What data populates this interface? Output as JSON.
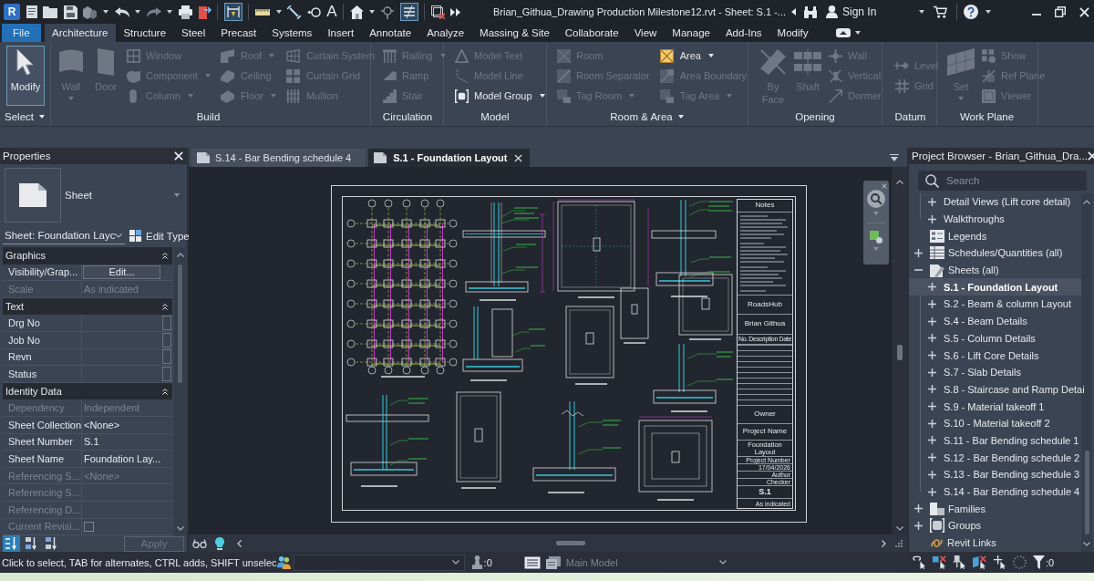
{
  "title_bar": {
    "logo": "R",
    "text_tool": "A",
    "title": "Brian_Githua_Drawing Production Milestone12.rvt - Sheet: S.1 -...",
    "sign_in": "Sign In"
  },
  "ribbon_tabs": [
    {
      "label": "File",
      "kind": "file",
      "selected": false
    },
    {
      "label": "Architecture",
      "kind": "tab",
      "selected": true
    },
    {
      "label": "Structure",
      "kind": "tab",
      "selected": false
    },
    {
      "label": "Steel",
      "kind": "tab",
      "selected": false
    },
    {
      "label": "Precast",
      "kind": "tab",
      "selected": false
    },
    {
      "label": "Systems",
      "kind": "tab",
      "selected": false
    },
    {
      "label": "Insert",
      "kind": "tab",
      "selected": false
    },
    {
      "label": "Annotate",
      "kind": "tab",
      "selected": false
    },
    {
      "label": "Analyze",
      "kind": "tab",
      "selected": false
    },
    {
      "label": "Massing & Site",
      "kind": "tab",
      "selected": false
    },
    {
      "label": "Collaborate",
      "kind": "tab",
      "selected": false
    },
    {
      "label": "View",
      "kind": "tab",
      "selected": false
    },
    {
      "label": "Manage",
      "kind": "tab",
      "selected": false
    },
    {
      "label": "Add-Ins",
      "kind": "tab",
      "selected": false
    },
    {
      "label": "Modify",
      "kind": "tab",
      "selected": false
    }
  ],
  "ribbon_panels": [
    {
      "label": "Select",
      "menu": true,
      "columns": [
        {
          "kind": "large",
          "label": "Modify",
          "disabled": false,
          "active": true,
          "menu": false
        }
      ]
    },
    {
      "label": "Build",
      "menu": false,
      "columns": [
        {
          "kind": "large",
          "label": "Wall",
          "disabled": true,
          "active": false,
          "menu": true
        },
        {
          "kind": "large",
          "label": "Door",
          "disabled": true,
          "active": false,
          "menu": false
        },
        {
          "kind": "stack",
          "tools": [
            {
              "label": "Window",
              "disabled": true,
              "menu": false
            },
            {
              "label": "Component",
              "disabled": true,
              "menu": true
            },
            {
              "label": "Column",
              "disabled": true,
              "menu": true
            }
          ]
        },
        {
          "kind": "stack",
          "tools": [
            {
              "label": "Roof",
              "disabled": true,
              "menu": true
            },
            {
              "label": "Ceiling",
              "disabled": true,
              "menu": false
            },
            {
              "label": "Floor",
              "disabled": true,
              "menu": true
            }
          ]
        },
        {
          "kind": "stack",
          "tools": [
            {
              "label": "Curtain System",
              "disabled": true,
              "menu": false
            },
            {
              "label": "Curtain Grid",
              "disabled": true,
              "menu": false
            },
            {
              "label": "Mullion",
              "disabled": true,
              "menu": false
            }
          ]
        }
      ]
    },
    {
      "label": "Circulation",
      "menu": false,
      "columns": [
        {
          "kind": "stack",
          "tools": [
            {
              "label": "Railing",
              "disabled": true,
              "menu": true
            },
            {
              "label": "Ramp",
              "disabled": true,
              "menu": false
            },
            {
              "label": "Stair",
              "disabled": true,
              "menu": false
            }
          ]
        }
      ]
    },
    {
      "label": "Model",
      "menu": false,
      "columns": [
        {
          "kind": "stack",
          "tools": [
            {
              "label": "Model Text",
              "disabled": true,
              "menu": false
            },
            {
              "label": "Model Line",
              "disabled": true,
              "menu": false
            },
            {
              "label": "Model Group",
              "disabled": false,
              "menu": true
            }
          ]
        }
      ]
    },
    {
      "label": "Room & Area",
      "menu": true,
      "columns": [
        {
          "kind": "stack",
          "tools": [
            {
              "label": "Room",
              "disabled": true,
              "menu": false
            },
            {
              "label": "Room Separator",
              "disabled": true,
              "menu": false
            },
            {
              "label": "Tag Room",
              "disabled": true,
              "menu": true
            }
          ]
        },
        {
          "kind": "stack",
          "tools": [
            {
              "label": "Area",
              "disabled": false,
              "menu": true
            },
            {
              "label": "Area Boundary",
              "disabled": true,
              "menu": false
            },
            {
              "label": "Tag Area",
              "disabled": true,
              "menu": true
            }
          ]
        }
      ]
    },
    {
      "label": "Opening",
      "menu": false,
      "columns": [
        {
          "kind": "large",
          "label": "By Face",
          "disabled": true,
          "active": false,
          "menu": false
        },
        {
          "kind": "large",
          "label": "Shaft",
          "disabled": true,
          "active": false,
          "menu": false
        },
        {
          "kind": "stack",
          "tools": [
            {
              "label": "Wall",
              "disabled": true,
              "menu": false
            },
            {
              "label": "Vertical",
              "disabled": true,
              "menu": false
            },
            {
              "label": "Dormer",
              "disabled": true,
              "menu": false
            }
          ]
        }
      ]
    },
    {
      "label": "Datum",
      "menu": false,
      "columns": [
        {
          "kind": "stack",
          "tools": [
            {
              "label": "Level",
              "disabled": true,
              "menu": false
            },
            {
              "label": "Grid",
              "disabled": true,
              "menu": false
            }
          ]
        }
      ]
    },
    {
      "label": "Work Plane",
      "menu": false,
      "columns": [
        {
          "kind": "large",
          "label": "Set",
          "disabled": true,
          "active": false,
          "menu": true
        },
        {
          "kind": "stack",
          "tools": [
            {
              "label": "Show",
              "disabled": true,
              "menu": false
            },
            {
              "label": "Ref Plane",
              "disabled": true,
              "menu": false
            },
            {
              "label": "Viewer",
              "disabled": true,
              "menu": false
            }
          ]
        }
      ]
    }
  ],
  "properties": {
    "title": "Properties",
    "type_name": "Sheet",
    "instance_filter": "Sheet: Foundation Layc",
    "edit_type": "Edit Type",
    "sections": [
      {
        "title": "Graphics",
        "expanded": true,
        "rows": [
          {
            "kind": "button",
            "label": "Visibility/Grap...",
            "value": "Edit...",
            "disabled": false
          },
          {
            "kind": "text",
            "label": "Scale",
            "value": "As indicated",
            "disabled": true
          }
        ]
      },
      {
        "title": "Text",
        "expanded": true,
        "rows": [
          {
            "kind": "field",
            "label": "Drg No",
            "disabled": false
          },
          {
            "kind": "field",
            "label": "Job No",
            "disabled": false
          },
          {
            "kind": "field",
            "label": "Revn",
            "disabled": false
          },
          {
            "kind": "field",
            "label": "Status",
            "disabled": false
          }
        ]
      },
      {
        "title": "Identity Data",
        "expanded": true,
        "rows": [
          {
            "kind": "text",
            "label": "Dependency",
            "value": "Independent",
            "disabled": true
          },
          {
            "kind": "text",
            "label": "Sheet Collection",
            "value": "<None>",
            "disabled": false
          },
          {
            "kind": "text",
            "label": "Sheet Number",
            "value": "S.1",
            "disabled": false
          },
          {
            "kind": "text",
            "label": "Sheet Name",
            "value": "Foundation Lay...",
            "disabled": false
          },
          {
            "kind": "text",
            "label": "Referencing S...",
            "value": "<None>",
            "disabled": true
          },
          {
            "kind": "text",
            "label": "Referencing S...",
            "disabled": true
          },
          {
            "kind": "text",
            "label": "Referencing D...",
            "disabled": true
          },
          {
            "kind": "checkbox",
            "label": "Current Revisi...",
            "checked": false,
            "disabled": true
          }
        ]
      }
    ],
    "sort_buttons": [
      {
        "selected": true
      },
      {
        "selected": false
      },
      {
        "selected": false
      }
    ],
    "apply": "Apply",
    "apply_disabled": true
  },
  "view": {
    "tabs": [
      {
        "label": "S.14 - Bar Bending schedule 4",
        "selected": false
      },
      {
        "label": "S.1 - Foundation Layout",
        "selected": true
      }
    ],
    "title_block": {
      "notes_heading": "Notes",
      "company": "RoadsHub",
      "designer": "Brian Githua",
      "revision_header": [
        "No.",
        "Description",
        "Date"
      ],
      "owner": "Owner",
      "project_name": "Project Name",
      "sheet_title": "Foundation Layout",
      "info_rows": [
        {
          "value": "Project Number"
        },
        {
          "value": "17/04/2026"
        },
        {
          "value": "Author"
        },
        {
          "value": "Checker"
        }
      ],
      "sheet_number": "S.1",
      "scale": "As indicated"
    }
  },
  "project_browser": {
    "title": "Project Browser - Brian_Githua_Dra...",
    "search_placeholder": "Search",
    "scrolled_branch": [
      {
        "label": "Detail Views (Lift core detail)",
        "expandable": true,
        "expanded": false,
        "selected": false
      },
      {
        "label": "Walkthroughs",
        "expandable": true,
        "expanded": false,
        "selected": false
      }
    ],
    "tree": [
      {
        "label": "Legends",
        "kind": "legend",
        "expandable": false,
        "selected": false
      },
      {
        "label": "Schedules/Quantities (all)",
        "kind": "schedule",
        "expandable": true,
        "expanded": false,
        "selected": false
      },
      {
        "label": "Sheets (all)",
        "kind": "sheet",
        "expandable": true,
        "expanded": true,
        "selected": false,
        "children": [
          {
            "label": "S.1 - Foundation Layout",
            "expandable": true,
            "expanded": false,
            "selected": true
          },
          {
            "label": "S.2 - Beam & column Layout",
            "expandable": true,
            "expanded": false,
            "selected": false
          },
          {
            "label": "S.4 - Beam Details",
            "expandable": true,
            "expanded": false,
            "selected": false
          },
          {
            "label": "S.5 - Column Details",
            "expandable": true,
            "expanded": false,
            "selected": false
          },
          {
            "label": "S.6 - Lift Core Details",
            "expandable": true,
            "expanded": false,
            "selected": false
          },
          {
            "label": "S.7 - Slab Details",
            "expandable": true,
            "expanded": false,
            "selected": false
          },
          {
            "label": "S.8 - Staircase and Ramp Detai",
            "expandable": true,
            "expanded": false,
            "selected": false
          },
          {
            "label": "S.9 - Material takeoff 1",
            "expandable": true,
            "expanded": false,
            "selected": false
          },
          {
            "label": "S.10 - Material takeoff 2",
            "expandable": true,
            "expanded": false,
            "selected": false
          },
          {
            "label": "S.11 - Bar Bending schedule 1",
            "expandable": true,
            "expanded": false,
            "selected": false
          },
          {
            "label": "S.12 - Bar Bending schedule 2",
            "expandable": true,
            "expanded": false,
            "selected": false
          },
          {
            "label": "S.13 - Bar Bending schedule 3",
            "expandable": true,
            "expanded": false,
            "selected": false
          },
          {
            "label": "S.14 - Bar Bending schedule 4",
            "expandable": true,
            "expanded": false,
            "selected": false
          }
        ]
      },
      {
        "label": "Families",
        "kind": "family",
        "expandable": true,
        "expanded": false,
        "selected": false
      },
      {
        "label": "Groups",
        "kind": "group",
        "expandable": true,
        "expanded": false,
        "selected": false
      },
      {
        "label": "Revit Links",
        "kind": "link",
        "expandable": false,
        "selected": false
      }
    ]
  },
  "status_bar": {
    "hint": "Click to select, TAB for alternates, CTRL adds, SHIFT unselec",
    "design_option_count": ":0",
    "active_model": {
      "value": "Main Model",
      "disabled": true
    },
    "filter_count": ":0"
  }
}
